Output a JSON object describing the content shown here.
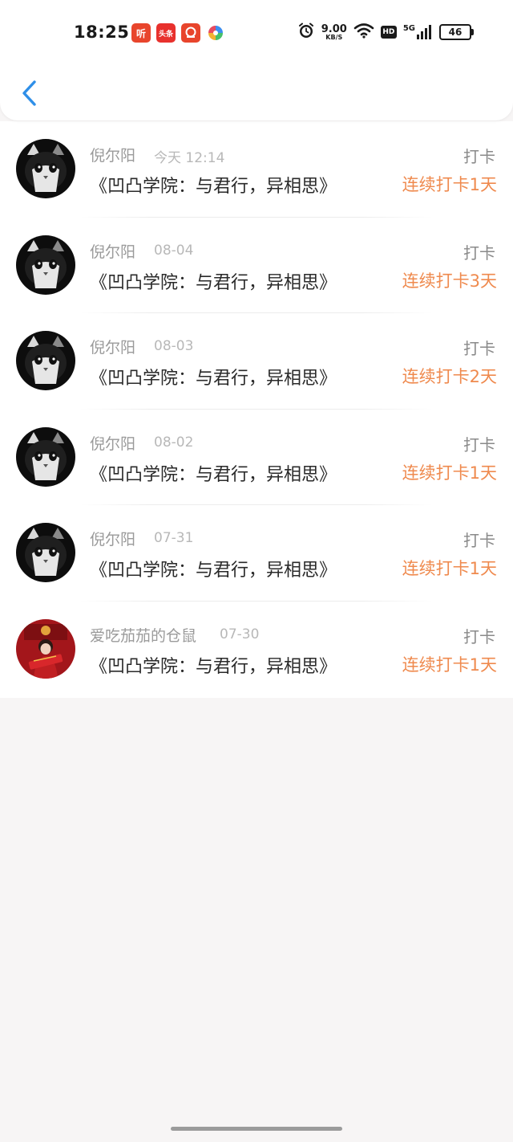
{
  "status_bar": {
    "time": "18:25",
    "notifications": [
      {
        "icon": "ting-app-icon",
        "label": "听",
        "color": "#e8452c"
      },
      {
        "icon": "toutiao-app-icon",
        "label": "头条",
        "color": "#e8312d"
      },
      {
        "icon": "pinduoduo-app-icon",
        "label": "",
        "color": "#e8452c"
      },
      {
        "icon": "pinwheel-app-icon",
        "label": "",
        "color": "#ffffff"
      }
    ],
    "net_speed_value": "9.00",
    "net_speed_unit": "KB/S",
    "hd_label": "HD",
    "signal_label": "5G",
    "battery": "46"
  },
  "nav": {
    "back_icon": "chevron-left-icon",
    "accent_color": "#2f8fe8"
  },
  "items": [
    {
      "name": "倪尔阳",
      "date": "今天 12:14",
      "title": "《凹凸学院：与君行，异相思》",
      "tag": "打卡",
      "streak": "连续打卡1天",
      "avatar": "cat-avatar"
    },
    {
      "name": "倪尔阳",
      "date": "08-04",
      "title": "《凹凸学院：与君行，异相思》",
      "tag": "打卡",
      "streak": "连续打卡3天",
      "avatar": "cat-avatar"
    },
    {
      "name": "倪尔阳",
      "date": "08-03",
      "title": "《凹凸学院：与君行，异相思》",
      "tag": "打卡",
      "streak": "连续打卡2天",
      "avatar": "cat-avatar"
    },
    {
      "name": "倪尔阳",
      "date": "08-02",
      "title": "《凹凸学院：与君行，异相思》",
      "tag": "打卡",
      "streak": "连续打卡1天",
      "avatar": "cat-avatar"
    },
    {
      "name": "倪尔阳",
      "date": "07-31",
      "title": "《凹凸学院：与君行，异相思》",
      "tag": "打卡",
      "streak": "连续打卡1天",
      "avatar": "cat-avatar"
    },
    {
      "name": "爱吃茄茄的仓鼠",
      "date": "07-30",
      "title": "《凹凸学院：与君行，异相思》",
      "tag": "打卡",
      "streak": "连续打卡1天",
      "avatar": "red-portrait-avatar"
    }
  ],
  "colors": {
    "streak": "#ef8a4e",
    "background": "#f7f5f5"
  }
}
